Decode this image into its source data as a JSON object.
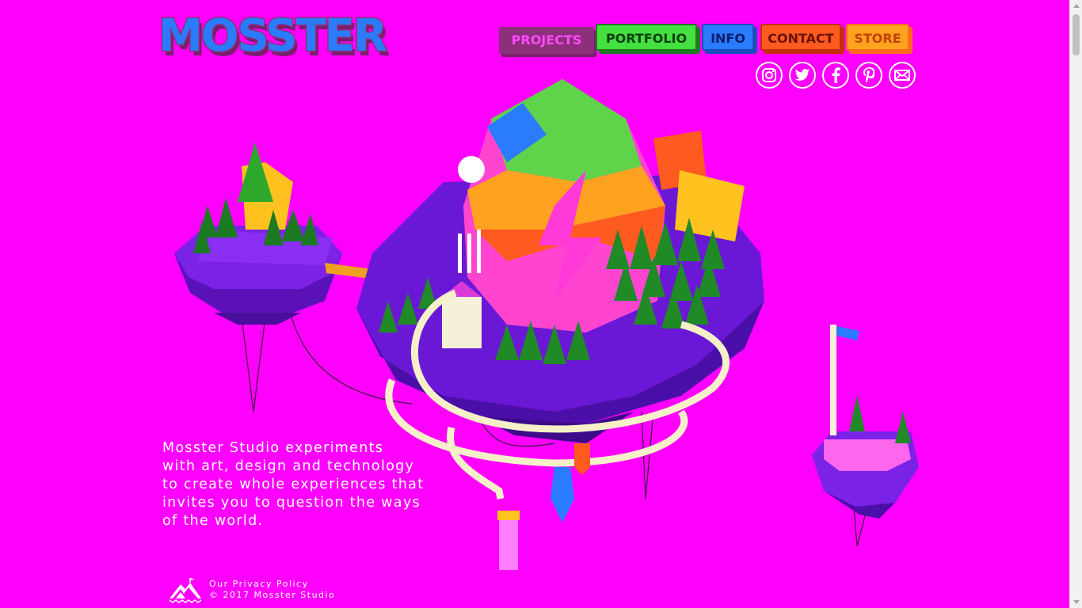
{
  "brand": {
    "logo_text": "MOSSTER",
    "background": "#ff00ff"
  },
  "nav": {
    "items": [
      {
        "label": "PROJECTS",
        "bg": "#8e2f7c",
        "fg": "#ff4bff",
        "active": true
      },
      {
        "label": "PORTFOLIO",
        "bg": "#44e040",
        "fg": "#0f3d10"
      },
      {
        "label": "INFO",
        "bg": "#2b7bff",
        "fg": "#0a1f66"
      },
      {
        "label": "CONTACT",
        "bg": "#ff5a1f",
        "fg": "#6a1206"
      },
      {
        "label": "STORE",
        "bg": "#ffa21f",
        "fg": "#c2410c"
      }
    ]
  },
  "social": [
    {
      "name": "instagram-icon"
    },
    {
      "name": "twitter-icon"
    },
    {
      "name": "facebook-icon"
    },
    {
      "name": "pinterest-icon"
    },
    {
      "name": "email-icon"
    }
  ],
  "intro": {
    "lines": [
      "Mosster Studio experiments",
      "with art, design and technology",
      "to create whole experiences that",
      "invites you to question the ways",
      "of the world."
    ]
  },
  "footer": {
    "privacy": "Our Privacy Policy",
    "copyright": "© 2017 Mosster Studio"
  }
}
